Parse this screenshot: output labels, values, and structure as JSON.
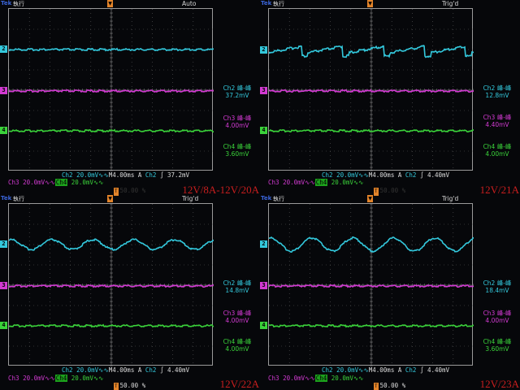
{
  "brand": "Tek",
  "run_state": "執行",
  "panels": [
    {
      "trigger_mode": "Auto",
      "condition": "12V/8A-12V/20A",
      "ch2": {
        "label": "Ch2 峰-峰",
        "value": "37.2mV"
      },
      "ch3": {
        "label": "Ch3 峰-峰",
        "value": "4.00mV"
      },
      "ch4": {
        "label": "Ch4 峰-峰",
        "value": "3.60mV"
      },
      "row1": {
        "ch": "Ch2",
        "scale": "20.0mV",
        "bw": "∿∿",
        "time": "M4.00ms",
        "a": "A",
        "trig_ch": "Ch2",
        "slope": "∫",
        "trig_level": "37.2mV"
      },
      "row2": {
        "ch3": "Ch3",
        "ch3_scale": "20.0mV",
        "ch3_bw": "∿∿",
        "ch4": "Ch4",
        "ch4_scale": "20.0mV",
        "ch4_bw": "∿∿"
      },
      "row3": {
        "t": "T",
        "pos": "50.00 %"
      },
      "row3_in_panel": false
    },
    {
      "trigger_mode": "Trig'd",
      "condition": "12V/21A",
      "ch2": {
        "label": "Ch2 峰-峰",
        "value": "12.8mV"
      },
      "ch3": {
        "label": "Ch3 峰-峰",
        "value": "4.40mV"
      },
      "ch4": {
        "label": "Ch4 峰-峰",
        "value": "4.00mV"
      },
      "row1": {
        "ch": "Ch2",
        "scale": "20.0mV",
        "bw": "∿∿",
        "time": "M4.00ms",
        "a": "A",
        "trig_ch": "Ch2",
        "slope": "∫",
        "trig_level": "4.40mV"
      },
      "row2": {
        "ch3": "Ch3",
        "ch3_scale": "20.0mV",
        "ch3_bw": "∿∿",
        "ch4": "Ch4",
        "ch4_scale": "20.0mV",
        "ch4_bw": "∿∿"
      },
      "row3": {
        "t": "T",
        "pos": "50.00 %"
      },
      "row3_in_panel": false
    },
    {
      "trigger_mode": "Trig'd",
      "condition": "12V/22A",
      "ch2": {
        "label": "Ch2 峰-峰",
        "value": "14.8mV"
      },
      "ch3": {
        "label": "Ch3 峰-峰",
        "value": "4.00mV"
      },
      "ch4": {
        "label": "Ch4 峰-峰",
        "value": "4.00mV"
      },
      "row1": {
        "ch": "Ch2",
        "scale": "20.0mV",
        "bw": "∿∿",
        "time": "M4.00ms",
        "a": "A",
        "trig_ch": "Ch2",
        "slope": "∫",
        "trig_level": "4.40mV"
      },
      "row2": {
        "ch3": "Ch3",
        "ch3_scale": "20.0mV",
        "ch3_bw": "∿∿",
        "ch4": "Ch4",
        "ch4_scale": "20.0mV",
        "ch4_bw": "∿∿"
      },
      "row3": {
        "t": "T",
        "pos": "50.00 %"
      },
      "row3_in_panel": true
    },
    {
      "trigger_mode": "Trig'd",
      "condition": "12V/23A",
      "ch2": {
        "label": "Ch2 峰-峰",
        "value": "18.4mV"
      },
      "ch3": {
        "label": "Ch3 峰-峰",
        "value": "4.00mV"
      },
      "ch4": {
        "label": "Ch4 峰-峰",
        "value": "3.60mV"
      },
      "row1": {
        "ch": "Ch2",
        "scale": "20.0mV",
        "bw": "∿∿",
        "time": "M4.00ms",
        "a": "A",
        "trig_ch": "Ch2",
        "slope": "∫",
        "trig_level": "4.40mV"
      },
      "row2": {
        "ch3": "Ch3",
        "ch3_scale": "20.0mV",
        "ch3_bw": "∿∿",
        "ch4": "Ch4",
        "ch4_scale": "20.0mV",
        "ch4_bw": "∿∿"
      },
      "row3": {
        "t": "T",
        "pos": "50.00 %"
      },
      "row3_in_panel": true
    }
  ],
  "channel_markers": [
    "2",
    "3",
    "4"
  ],
  "colors": {
    "ch2": "#33c8dc",
    "ch3": "#d23ad2",
    "ch4": "#3ad23a",
    "grid": "#5a5a5a",
    "condition": "#c81e1e",
    "trigger_marker": "#e3842a"
  },
  "waveforms": [
    {
      "type": "flat"
    },
    {
      "type": "sawtooth",
      "cycles": 5
    },
    {
      "type": "sine",
      "cycles": 5
    },
    {
      "type": "sine",
      "cycles": 5
    }
  ]
}
